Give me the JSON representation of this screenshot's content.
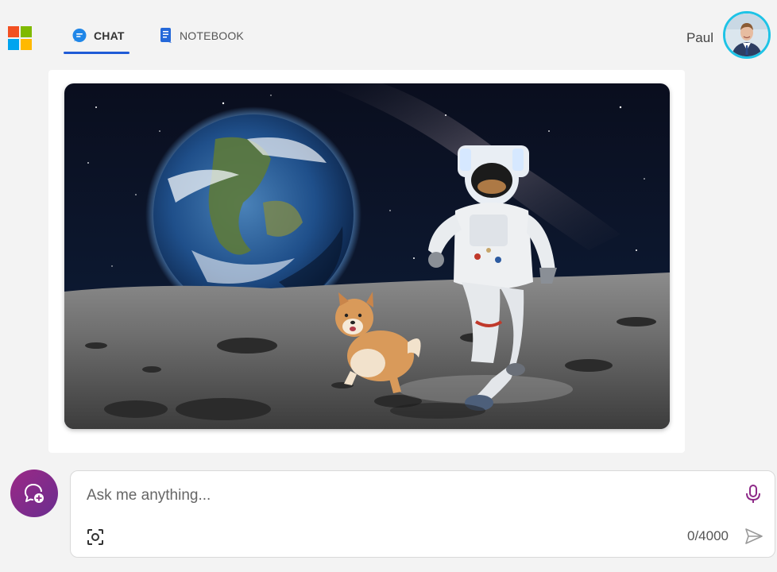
{
  "header": {
    "tabs": [
      {
        "label": "CHAT",
        "icon": "chat-icon",
        "active": true
      },
      {
        "label": "NOTEBOOK",
        "icon": "notebook-icon",
        "active": false
      }
    ],
    "user_name": "Paul"
  },
  "colors": {
    "ms_red": "#f25022",
    "ms_green": "#7fba00",
    "ms_blue": "#00a4ef",
    "ms_yellow": "#ffb900",
    "accent_blue": "#1f5bd6",
    "avatar_ring": "#1ec3e6",
    "new_topic_purple": "#8e2a88"
  },
  "image": {
    "description_icon": "generated-image"
  },
  "composer": {
    "placeholder": "Ask me anything...",
    "value": "",
    "char_count": "0/4000"
  }
}
